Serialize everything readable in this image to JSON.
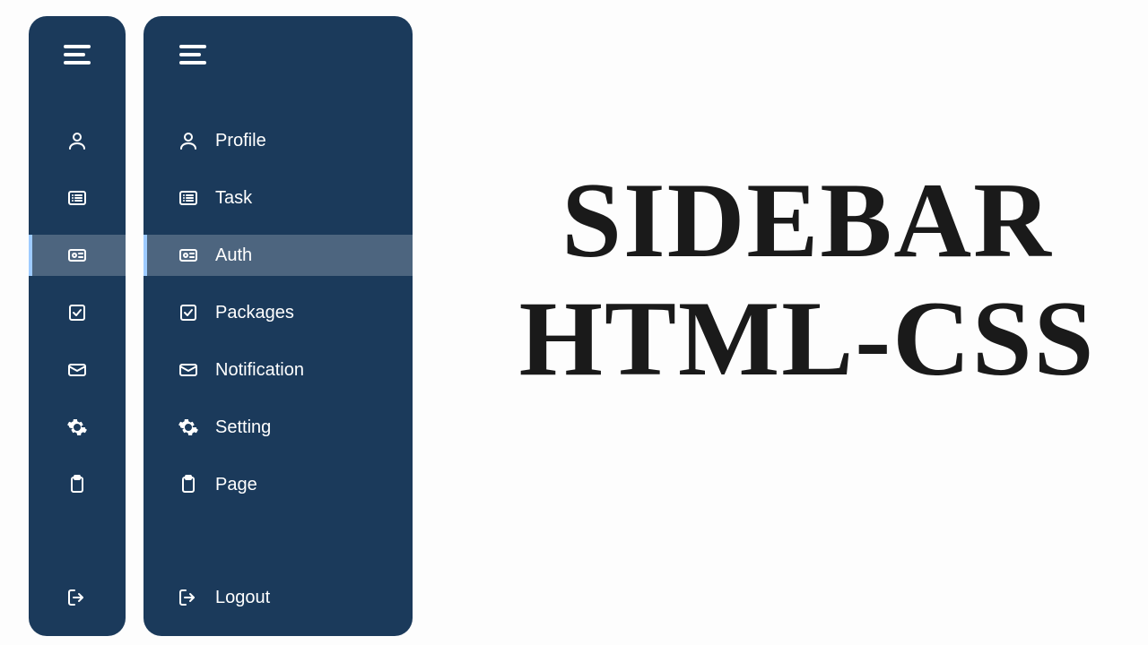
{
  "hero": {
    "line1": "SIDEBAR",
    "line2": "HTML-CSS"
  },
  "sidebar": {
    "items": [
      {
        "id": "profile",
        "label": "Profile",
        "icon": "user-icon",
        "active": false
      },
      {
        "id": "task",
        "label": "Task",
        "icon": "list-icon",
        "active": false
      },
      {
        "id": "auth",
        "label": "Auth",
        "icon": "id-card-icon",
        "active": true
      },
      {
        "id": "packages",
        "label": "Packages",
        "icon": "checkbox-icon",
        "active": false
      },
      {
        "id": "notification",
        "label": "Notification",
        "icon": "envelope-icon",
        "active": false
      },
      {
        "id": "setting",
        "label": "Setting",
        "icon": "gear-icon",
        "active": false
      },
      {
        "id": "page",
        "label": "Page",
        "icon": "clipboard-icon",
        "active": false
      }
    ],
    "logout": {
      "label": "Logout",
      "icon": "logout-icon"
    }
  },
  "colors": {
    "sidebar_bg": "#1b3a5b",
    "active_bg": "rgba(255,255,255,0.22)",
    "active_border": "#9ecbff",
    "text": "#ffffff"
  }
}
